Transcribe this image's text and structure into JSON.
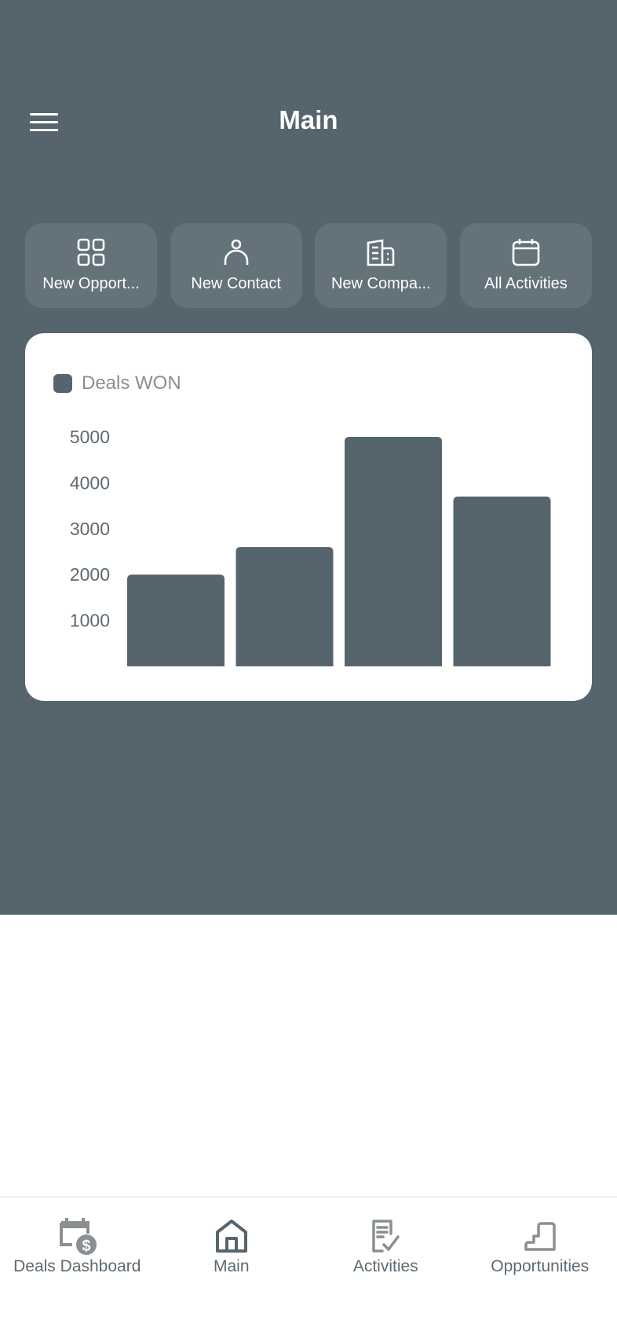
{
  "header": {
    "title": "Main",
    "menu_icon": "hamburger-menu-icon"
  },
  "quick_actions": [
    {
      "label": "New Opport...",
      "icon": "grid-icon"
    },
    {
      "label": "New Contact",
      "icon": "person-icon"
    },
    {
      "label": "New Compa...",
      "icon": "building-icon"
    },
    {
      "label": "All Activities",
      "icon": "calendar-icon"
    }
  ],
  "colors": {
    "primary": "#56646d",
    "button_bg": "#64727a",
    "card_bg": "#ffffff",
    "muted_text": "#888e92"
  },
  "chart_data": {
    "type": "bar",
    "title": "",
    "legend": [
      {
        "name": "Deals WON",
        "color": "#56646d"
      }
    ],
    "legend_position": "top-left",
    "categories": [
      "",
      "",
      "",
      ""
    ],
    "series": [
      {
        "name": "Deals WON",
        "values": [
          2000,
          2600,
          5000,
          3700
        ]
      }
    ],
    "yticks": [
      1000,
      2000,
      3000,
      4000,
      5000
    ],
    "ylim": [
      0,
      5000
    ],
    "xlabel": "",
    "ylabel": "",
    "grid": false
  },
  "bottom_nav": [
    {
      "label": "Deals Dashboard",
      "icon": "calendar-dollar-icon",
      "active": false
    },
    {
      "label": "Main",
      "icon": "home-icon",
      "active": true
    },
    {
      "label": "Activities",
      "icon": "checklist-icon",
      "active": false
    },
    {
      "label": "Opportunities",
      "icon": "stairs-icon",
      "active": false
    }
  ]
}
